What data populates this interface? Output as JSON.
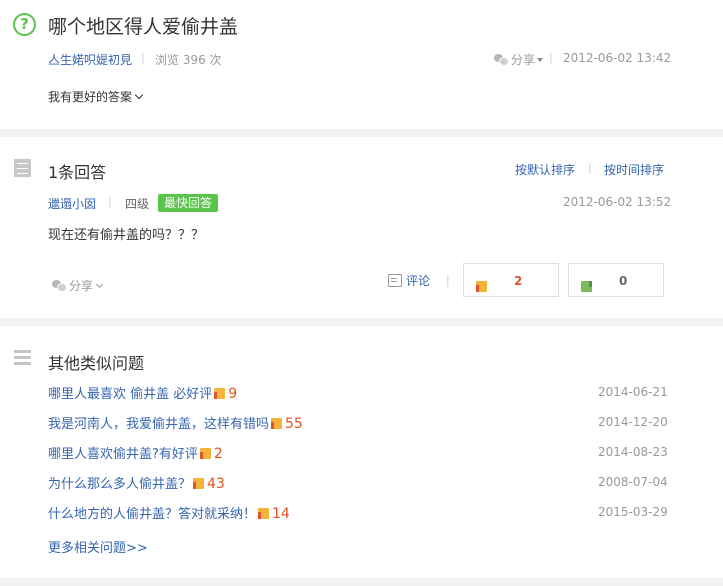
{
  "question": {
    "icon": "question-circle-icon",
    "title": "哪个地区得人爱偷井盖",
    "asker": "亼生婼呮媞初見",
    "views": "浏览 396 次",
    "share": "分享",
    "time": "2012-06-02 13:42",
    "better_answer": "我有更好的答案"
  },
  "answers": {
    "title": "1条回答",
    "sort_default": "按默认排序",
    "sort_time": "按时间排序",
    "items": [
      {
        "user": "邋遢小囡",
        "level": "四级",
        "badge": "最快回答",
        "time": "2012-06-02 13:52",
        "content": "现在还有偷井盖的吗？？？",
        "share": "分享",
        "comment": "评论",
        "up": "2",
        "down": "0"
      }
    ]
  },
  "similar": {
    "title": "其他类似问题",
    "items": [
      {
        "title": "哪里人最喜欢 偷井盖 必好评",
        "likes": "9",
        "date": "2014-06-21"
      },
      {
        "title": "我是河南人，我爱偷井盖，这样有错吗",
        "likes": "55",
        "date": "2014-12-20"
      },
      {
        "title": "哪里人喜欢偷井盖?有好评",
        "likes": "2",
        "date": "2014-08-23"
      },
      {
        "title": "为什么那么多人偷井盖？",
        "likes": "43",
        "date": "2008-07-04"
      },
      {
        "title": "什么地方的人偷井盖？答对就采纳！",
        "likes": "14",
        "date": "2015-03-29"
      }
    ],
    "more": "更多相关问题>>"
  },
  "colors": {
    "link": "#3565b0",
    "accent_green": "#5ac54b",
    "like_orange": "#e0521e",
    "up_red": "#e2552c"
  }
}
